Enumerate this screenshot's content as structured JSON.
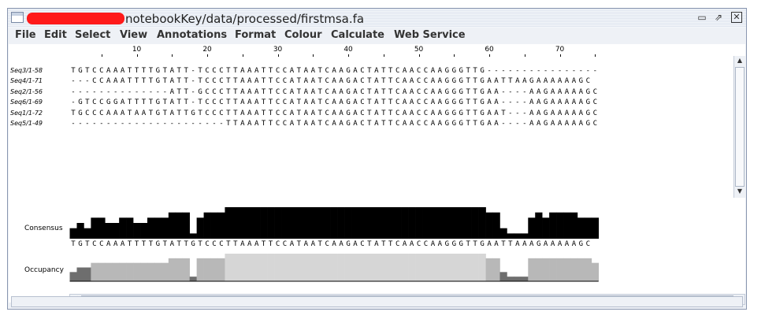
{
  "window": {
    "title": "notebookKey/data/processed/firstmsa.fa",
    "controls": {
      "minimize": "▭",
      "maximize": "⇗",
      "close": "✕"
    }
  },
  "menu": [
    "File",
    "Edit",
    "Select",
    "View",
    "Annotations",
    "Format",
    "Colour",
    "Calculate",
    "Web Service"
  ],
  "ruler": {
    "labels": [
      "10",
      "20",
      "30",
      "40",
      "50",
      "60",
      "70"
    ]
  },
  "sequences": [
    {
      "name": "Seq3/1-58",
      "residues": "TGTCCAAATTTTGTATT-TCCCTTAAATTCCATAATCAAGACTATTCAACCAAGGGTTG----------------"
    },
    {
      "name": "Seq4/1-71",
      "residues": "---CCAAATTTTGTATT-TCCCTTAAATTCCATAATCAAGACTATTCAACCAAGGGTTGAATTAAGAAAAAAGC"
    },
    {
      "name": "Seq2/1-56",
      "residues": "--------------ATT-GCCCTTAAATTCCATAATCAAGACTATTCAACCAAGGGTTGAA----AAGAAAAAGC"
    },
    {
      "name": "Seq6/1-69",
      "residues": "-GTCCGGATTTTGTATT-TCCCTTAAATTCCATAATCAAGACTATTCAACCAAGGGTTGAA----AAGAAAAAGC"
    },
    {
      "name": "Seq1/1-72",
      "residues": "TGCCCAAATAATGTATTGTCCCTTAAATTCCATAATCAAGACTATTCAACCAAGGGTTGAAT---AAGAAAAAGC"
    },
    {
      "name": "Seq5/1-49",
      "residues": "----------------------TTAAATTCCATAATCAAGACTATTCAACCAAGGGTTGAA----AAGAAAAAGC"
    }
  ],
  "annotations": {
    "consensus_label": "Consensus",
    "occupancy_label": "Occupancy",
    "consensus_sequence": "TGTCCAAATTTTGTATTGTCCCTTAAATTCCATAATCAAGACTATTCAACCAAGGGTTGAATTAAAGAAAAAGC",
    "colors": {
      "consensus": "#000000",
      "occupancy_light": "#d6d6d6",
      "occupancy_mid": "#b8b8b8",
      "occupancy_dark": "#6e6e6e"
    }
  },
  "scroll": {
    "up": "▲",
    "down": "▼",
    "left": "◀",
    "right": "▶"
  }
}
